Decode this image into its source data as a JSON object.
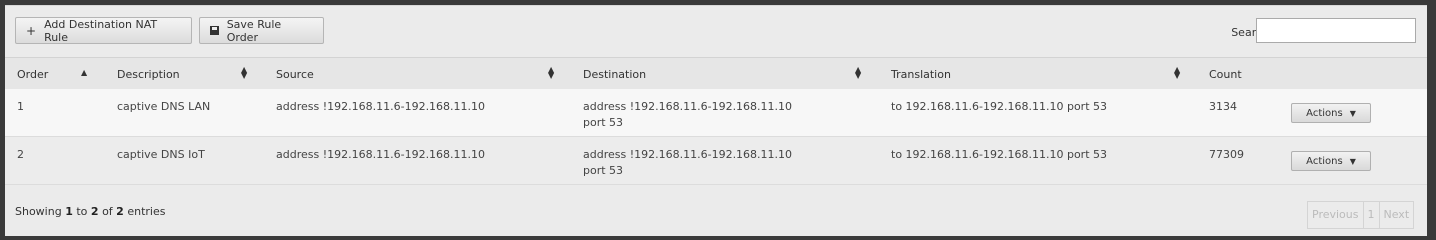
{
  "toolbar": {
    "add_label": "Add Destination NAT Rule",
    "save_label": "Save Rule Order",
    "search_label": "Search",
    "search_value": ""
  },
  "columns": [
    "Order",
    "Description",
    "Source",
    "Destination",
    "Translation",
    "Count"
  ],
  "rows": [
    {
      "order": "1",
      "description": "captive DNS LAN",
      "source": "address !192.168.11.6-192.168.11.10",
      "destination_line1": "address !192.168.11.6-192.168.11.10",
      "destination_line2": "port 53",
      "translation": "to 192.168.11.6-192.168.11.10 port 53",
      "count": "3134",
      "actions_label": "Actions"
    },
    {
      "order": "2",
      "description": "captive DNS IoT",
      "source": "address !192.168.11.6-192.168.11.10",
      "destination_line1": "address !192.168.11.6-192.168.11.10",
      "destination_line2": "port 53",
      "translation": "to 192.168.11.6-192.168.11.10 port 53",
      "count": "77309",
      "actions_label": "Actions"
    }
  ],
  "footer": {
    "showing": "Showing",
    "start": "1",
    "to": "to",
    "end": "2",
    "of": "of",
    "total": "2",
    "entries": "entries"
  },
  "pagination": {
    "previous": "Previous",
    "page": "1",
    "next": "Next"
  }
}
